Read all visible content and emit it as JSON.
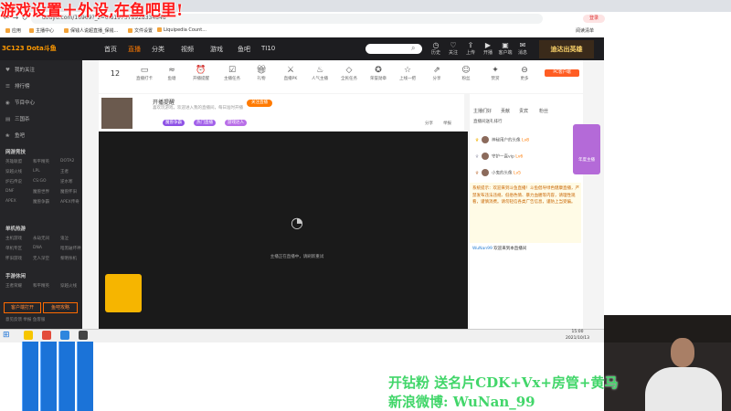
{
  "overlay_title": "游戏设置＋外设,在鱼吧里!",
  "browser": {
    "url": "douyu.com/16969?_z=0.8197578928334848",
    "tab_label": "斗鱼",
    "bookmarks": [
      "应用",
      "主播中心",
      "保钱人说超直播_保钱...",
      "文件设置",
      "Liquipedia Count..."
    ],
    "right_bookmark": "阅读清单",
    "user_chip": "登录"
  },
  "site": {
    "logo": "3C123 Dota斗鱼",
    "nav": [
      "首页",
      "直播",
      "分类",
      "视频",
      "游戏",
      "鱼吧",
      "TI10"
    ],
    "active_nav": "直播",
    "header_icons": [
      {
        "icon": "history-icon",
        "label": "历史"
      },
      {
        "icon": "follow-icon",
        "label": "关注"
      },
      {
        "icon": "upload-icon",
        "label": "上传"
      },
      {
        "icon": "open-live-icon",
        "label": "开播"
      },
      {
        "icon": "client-icon",
        "label": "客户端"
      },
      {
        "icon": "message-icon",
        "label": "消息"
      }
    ],
    "banner": "迪达出英雄"
  },
  "sidebar": {
    "top_items": [
      {
        "icon": "heart-icon",
        "label": "我的关注"
      },
      {
        "icon": "rank-icon",
        "label": "排行榜"
      },
      {
        "icon": "task-icon",
        "label": "节目中心"
      },
      {
        "icon": "store-icon",
        "label": "三国杀"
      },
      {
        "icon": "fish-icon",
        "label": "鱼吧"
      }
    ],
    "sections": [
      {
        "title": "网游竞技",
        "rows": [
          [
            "英雄联盟",
            "和平精英",
            "DOTA2"
          ],
          [
            "穿越火线",
            "LPL",
            "王者"
          ],
          [
            "炉石传说",
            "CS:GO",
            "逆水寒"
          ],
          [
            "DNF",
            "魔兽世界",
            "魔兽怀旧"
          ],
          [
            "APEX",
            "魔兽争霸",
            "APEX传奇"
          ]
        ]
      },
      {
        "title": "单机热游",
        "rows": [
          [
            "主机游戏",
            "永劫无间",
            "鬼泣"
          ],
          [
            "单机专区",
            "DNA",
            "暗黑破坏神"
          ],
          [
            "怀旧游戏",
            "无人深空",
            "黎明杀机"
          ]
        ]
      },
      {
        "title": "手游休闲",
        "rows": [
          [
            "王者荣耀",
            "和平精英",
            "穿越火线"
          ]
        ]
      }
    ],
    "btn1": "客户端打开",
    "btn2": "鱼吧攻略",
    "footer": "意见反馈  举报  鱼客服"
  },
  "toolbar": {
    "follow_count": "12",
    "items": [
      "直播打卡",
      "鱼塘",
      "开播提醒",
      "主播任务",
      "礼物",
      "直播PK",
      "人气主播",
      "全民任务",
      "荣誉勋章",
      "上线一把",
      "分享",
      "粉丝",
      "赞赏",
      "更多"
    ],
    "pc_button": "PC客户端"
  },
  "room": {
    "streamer": "开播提醒",
    "description": "喜欢玩游戏，欢迎进入我的直播间，每日准时开播",
    "follow_button": "关注直播",
    "tags": [
      "魔兽争霸",
      "热门直播",
      "游戏达人"
    ],
    "loading_text": "主播正在直播中，请刷新重试",
    "right_controls": [
      "分享",
      "举报"
    ]
  },
  "chat": {
    "tabs": [
      "主播们好",
      "贡献",
      "贵宾",
      "粉丝"
    ],
    "rank_title": "直播间送礼排行",
    "ranks": [
      {
        "name": "神秘用户的头像",
        "badge": "Lv8"
      },
      {
        "name": "守护一直vip",
        "badge": "Lv6"
      },
      {
        "name": "小鬼的头像",
        "badge": "Lv5"
      }
    ],
    "notice": "系统提示：欢迎来到斗鱼直播！斗鱼倡导绿色健康直播，严禁发布违法违规、低俗色情、暴力血腥等内容，请理性观看，谨慎消费。请勿轻信各类广告信息，谨防上当受骗。",
    "chat_user": "WuNan99",
    "chat_text": "欢迎来到本直播间",
    "gift_label": "年度主播"
  },
  "taskbar": {
    "time": "15:00",
    "date": "2021/10/13"
  },
  "promo": {
    "line1": "开钻粉 送名片CDK+Vx+房管+黄马",
    "line2": "新浪微博: WuNan_99"
  }
}
